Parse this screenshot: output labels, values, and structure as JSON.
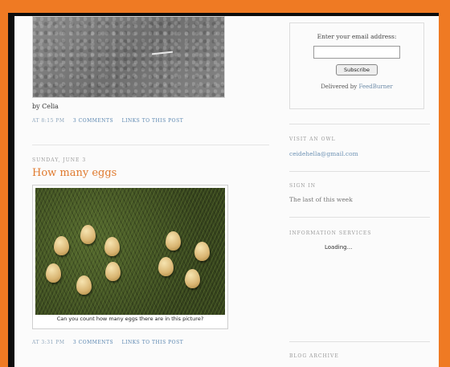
{
  "post_top": {
    "byline": "by Celia"
  },
  "post_top_meta": {
    "time": "AT 8:15 PM",
    "comments": "3 COMMENTS",
    "link": "LINKS TO THIS POST"
  },
  "post": {
    "date": "SUNDAY, JUNE 3",
    "title": "How many eggs",
    "caption": "Can you count how many eggs there are in this picture?",
    "meta": {
      "time": "AT 3:31 PM",
      "comments": "3 COMMENTS",
      "link": "LINKS TO THIS POST"
    }
  },
  "sidebar": {
    "subscribe": {
      "label": "Enter your email address:",
      "button": "Subscribe",
      "delivered_prefix": "Delivered by",
      "delivered_by": "FeedBurner"
    },
    "visit": {
      "heading": "VISIT AN OWL",
      "value": "ceidehella@gmail.com"
    },
    "sign_in": {
      "heading": "SIGN IN",
      "value": "The last of this week"
    },
    "widget": {
      "heading": "INFORMATION SERVICES",
      "status": "Loading..."
    },
    "archive": {
      "heading": "BLOG ARCHIVE"
    }
  },
  "colors": {
    "border_orange": "#ef7a23",
    "title_orange": "#e07a2e",
    "link_blue": "#5a86b0"
  }
}
